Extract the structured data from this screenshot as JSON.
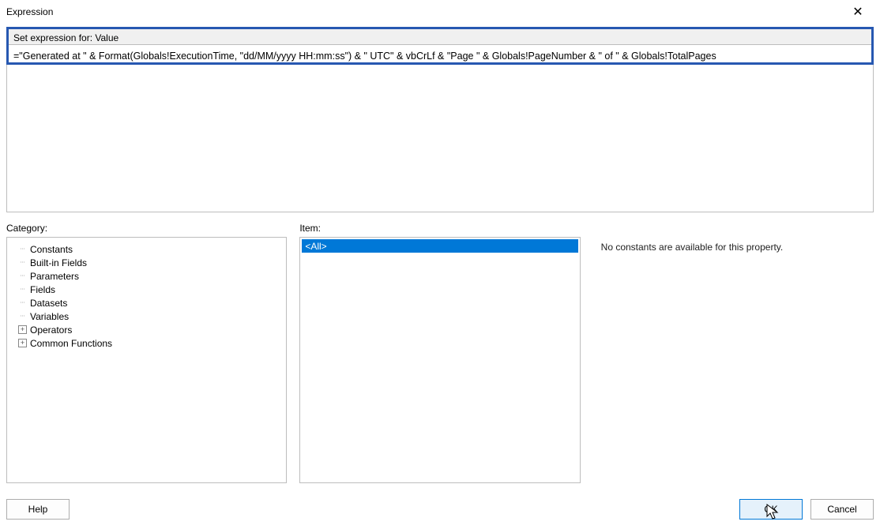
{
  "titlebar": {
    "title": "Expression",
    "close_glyph": "✕"
  },
  "set_label": "Set expression for: Value",
  "editor": {
    "value": "=\"Generated at \" & Format(Globals!ExecutionTime, \"dd/MM/yyyy HH:mm:ss\") & \" UTC\" & vbCrLf & \"Page \" & Globals!PageNumber & \" of \" & Globals!TotalPages"
  },
  "category": {
    "label": "Category:",
    "items": [
      {
        "label": "Constants",
        "expand": null
      },
      {
        "label": "Built-in Fields",
        "expand": null
      },
      {
        "label": "Parameters",
        "expand": null
      },
      {
        "label": "Fields",
        "expand": null
      },
      {
        "label": "Datasets",
        "expand": null
      },
      {
        "label": "Variables",
        "expand": null
      },
      {
        "label": "Operators",
        "expand": "+"
      },
      {
        "label": "Common Functions",
        "expand": "+"
      }
    ]
  },
  "item": {
    "label": "Item:",
    "rows": [
      {
        "label": "<All>",
        "selected": true
      }
    ]
  },
  "values": {
    "text": "No constants are available for this property."
  },
  "footer": {
    "help": "Help",
    "ok": "OK",
    "cancel": "Cancel"
  }
}
